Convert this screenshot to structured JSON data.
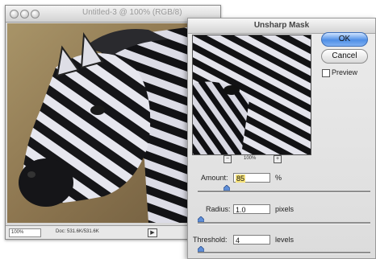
{
  "document_window": {
    "title": "Untitled-3 @ 100% (RGB/8)",
    "zoom": "100%",
    "doc_info": "Doc: 531.6K/531.6K"
  },
  "dialog": {
    "title": "Unsharp Mask",
    "ok_label": "OK",
    "cancel_label": "Cancel",
    "preview_label": "Preview",
    "preview_checked": false,
    "preview_zoom": "100%",
    "amount": {
      "label": "Amount:",
      "value": "85",
      "unit": "%",
      "slider_fraction": 0.17
    },
    "radius": {
      "label": "Radius:",
      "value": "1.0",
      "unit": "pixels",
      "slider_fraction": 0.02
    },
    "threshold": {
      "label": "Threshold:",
      "value": "4",
      "unit": "levels",
      "slider_fraction": 0.02
    }
  },
  "colors": {
    "ok_button": "#4f8fe6",
    "amount_highlight": "#f6e27a"
  }
}
